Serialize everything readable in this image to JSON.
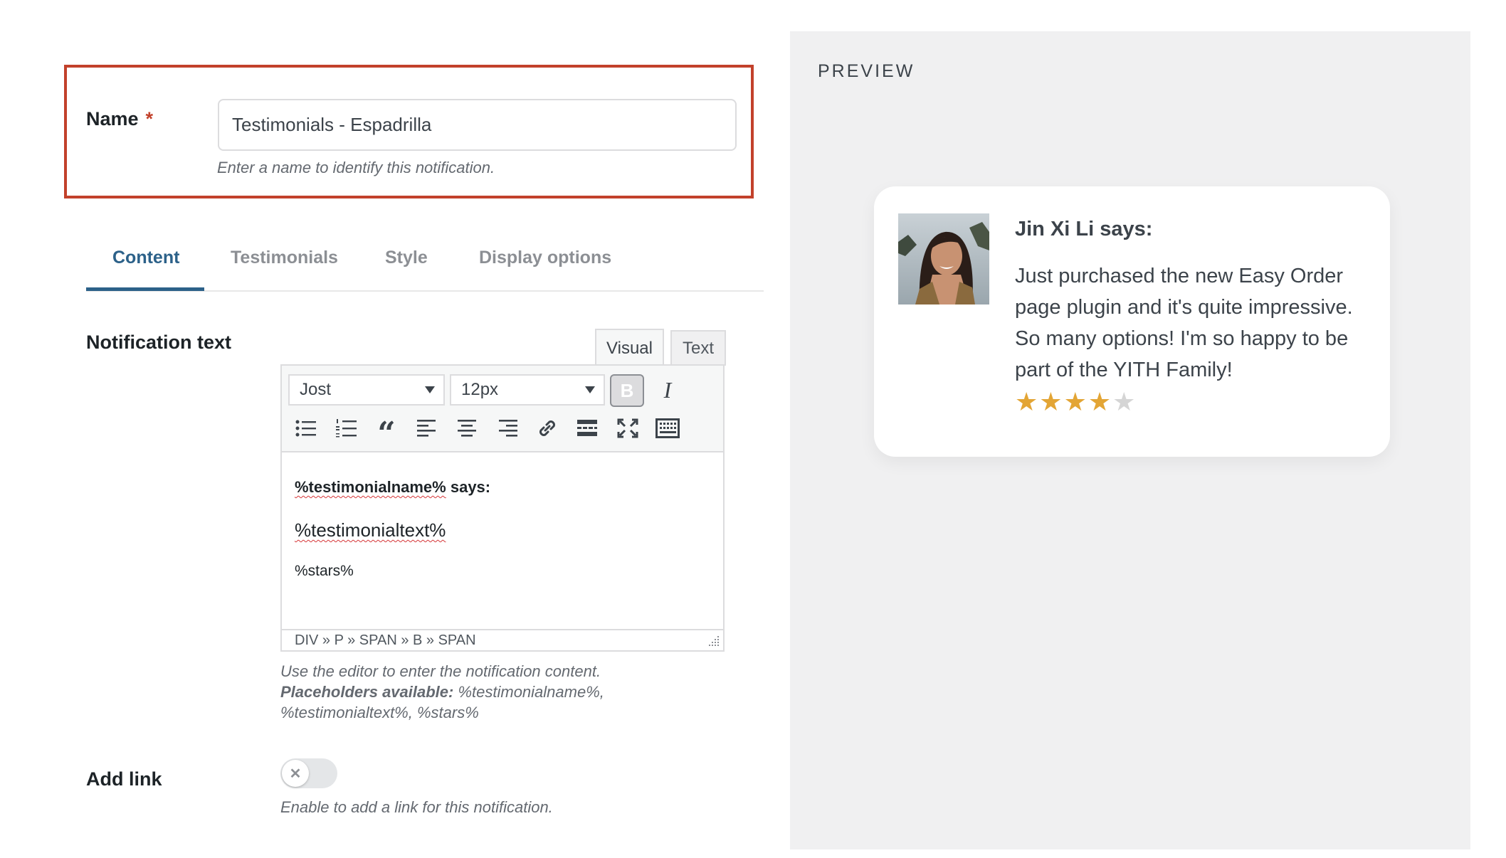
{
  "name_section": {
    "label": "Name",
    "required_mark": "*",
    "value": "Testimonials - Espadrilla",
    "help": "Enter a name to identify this notification."
  },
  "tabs": [
    {
      "label": "Content",
      "active": true
    },
    {
      "label": "Testimonials",
      "active": false
    },
    {
      "label": "Style",
      "active": false
    },
    {
      "label": "Display options",
      "active": false
    }
  ],
  "notification": {
    "label": "Notification text",
    "mode_tabs": {
      "visual": "Visual",
      "text": "Text"
    },
    "font_select": "Jost",
    "size_select": "12px",
    "bold_glyph": "B",
    "italic_glyph": "I",
    "content": {
      "line1_placeholder": "%testimonialname%",
      "line1_suffix": " says:",
      "line2": "%testimonialtext%",
      "line3": "%stars%"
    },
    "path": "DIV » P » SPAN » B » SPAN",
    "help_line1": "Use the editor to enter the notification content.",
    "help_bold": "Placeholders available:",
    "help_placeholders_a": " %testimonialname%,",
    "help_placeholders_b": "%testimonialtext%, %stars%"
  },
  "add_link": {
    "label": "Add link",
    "enabled": false,
    "toggle_glyph": "✕",
    "help": "Enable to add a link for this notification."
  },
  "preview": {
    "title": "PREVIEW",
    "card": {
      "author": "Jin Xi Li says:",
      "text": "Just purchased the new Easy Order page plugin and it's quite impressive. So many options! I'm so happy to be part of the YITH Family!",
      "rating": 4,
      "max_rating": 5
    }
  },
  "colors": {
    "accent": "#2c6189",
    "highlight_border": "#c2412b",
    "star_filled": "#e3a535",
    "star_empty": "#d5d5d5"
  }
}
